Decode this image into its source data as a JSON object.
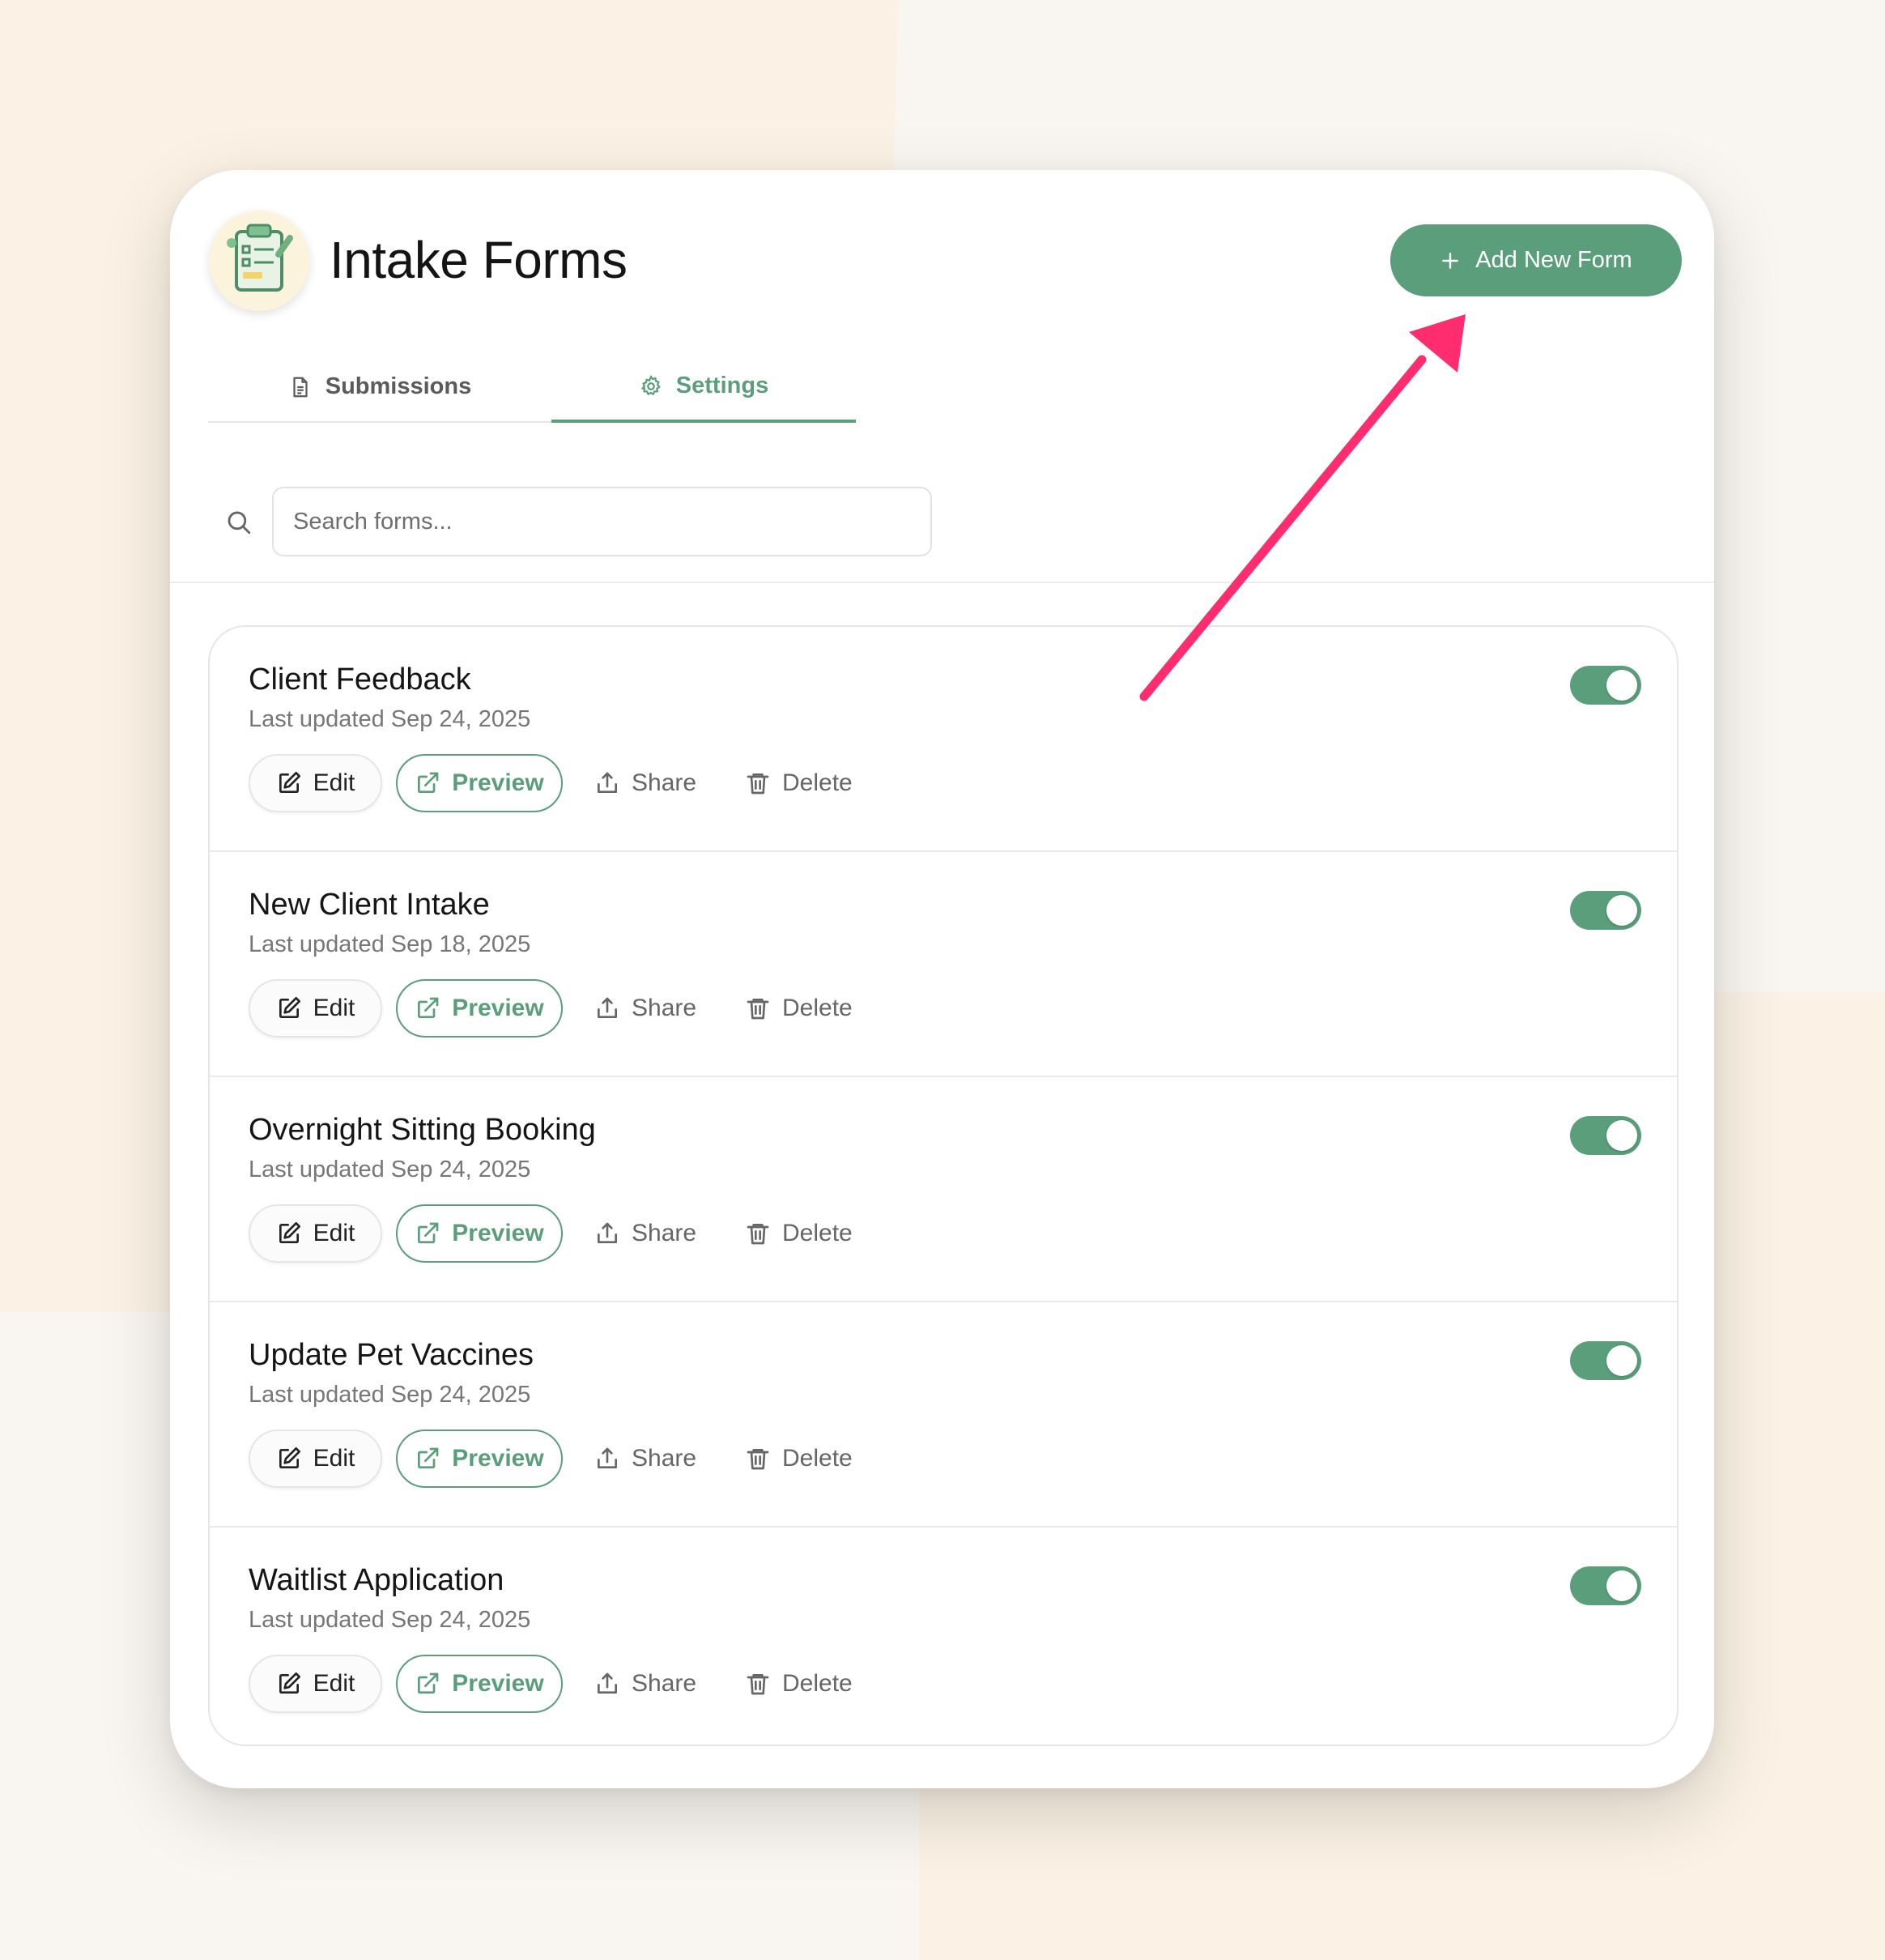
{
  "page": {
    "title": "Intake Forms",
    "add_button_label": "Add New Form"
  },
  "tabs": [
    {
      "label": "Submissions",
      "active": false
    },
    {
      "label": "Settings",
      "active": true
    }
  ],
  "search": {
    "placeholder": "Search forms..."
  },
  "forms": [
    {
      "title": "Client Feedback",
      "updated": "Last updated Sep 24, 2025",
      "enabled": true
    },
    {
      "title": "New Client Intake",
      "updated": "Last updated Sep 18, 2025",
      "enabled": true
    },
    {
      "title": "Overnight Sitting Booking",
      "updated": "Last updated Sep 24, 2025",
      "enabled": true
    },
    {
      "title": "Update Pet Vaccines",
      "updated": "Last updated Sep 24, 2025",
      "enabled": true
    },
    {
      "title": "Waitlist Application",
      "updated": "Last updated Sep 24, 2025",
      "enabled": true
    }
  ],
  "row_actions": {
    "edit": "Edit",
    "preview": "Preview",
    "share": "Share",
    "delete": "Delete"
  },
  "icons": {
    "logo": "clipboard-icon",
    "add": "plus-icon",
    "submissions_tab": "document-icon",
    "settings_tab": "gear-icon",
    "search": "search-icon",
    "edit": "edit-icon",
    "preview": "external-link-icon",
    "share": "share-icon",
    "delete": "trash-icon"
  },
  "colors": {
    "accent": "#5a9e7b",
    "annotation_arrow": "#ff2d6f",
    "background": "#f9f6f1"
  }
}
